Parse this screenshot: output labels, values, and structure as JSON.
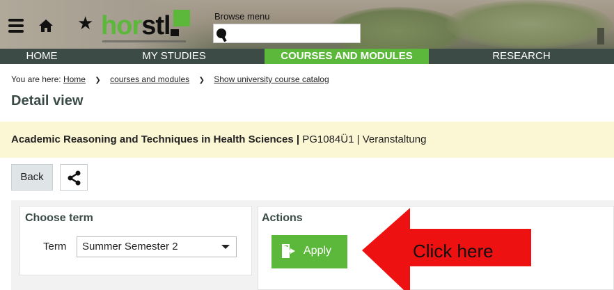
{
  "header": {
    "browse_label": "Browse menu",
    "logo": {
      "part1": "hor",
      "part2": "stl"
    },
    "icons": {
      "menu": "menu-icon",
      "home": "home-icon",
      "favorites": "star-icon",
      "search": "search-icon"
    },
    "star_glyph": "★"
  },
  "nav": {
    "items": [
      {
        "label": "HOME"
      },
      {
        "label": "MY STUDIES"
      },
      {
        "label": "COURSES AND MODULES",
        "active": true
      },
      {
        "label": "RESEARCH"
      }
    ]
  },
  "breadcrumb": {
    "prefix": "You are here:",
    "items": [
      "Home",
      "courses and modules",
      "Show university course catalog"
    ],
    "separator": "❯"
  },
  "page": {
    "title": "Detail view"
  },
  "course": {
    "name": "Academic Reasoning and Techniques in Health Sciences",
    "sep": " | ",
    "code": "PG1084Ü1",
    "sep2": " | ",
    "type": "Veranstaltung"
  },
  "toolbar": {
    "back_label": "Back",
    "share_icon": "share-icon"
  },
  "term_panel": {
    "heading": "Choose term",
    "label": "Term",
    "selected": "Summer Semester 2"
  },
  "actions_panel": {
    "heading": "Actions",
    "apply_label": "Apply",
    "apply_icon": "door-enter-icon"
  },
  "annotation": {
    "text": "Click here"
  },
  "colors": {
    "brand_green": "#5cb83a",
    "nav_bg": "#3d4b47",
    "info_bg": "#fbf6d3",
    "arrow_red": "#ee1111"
  }
}
